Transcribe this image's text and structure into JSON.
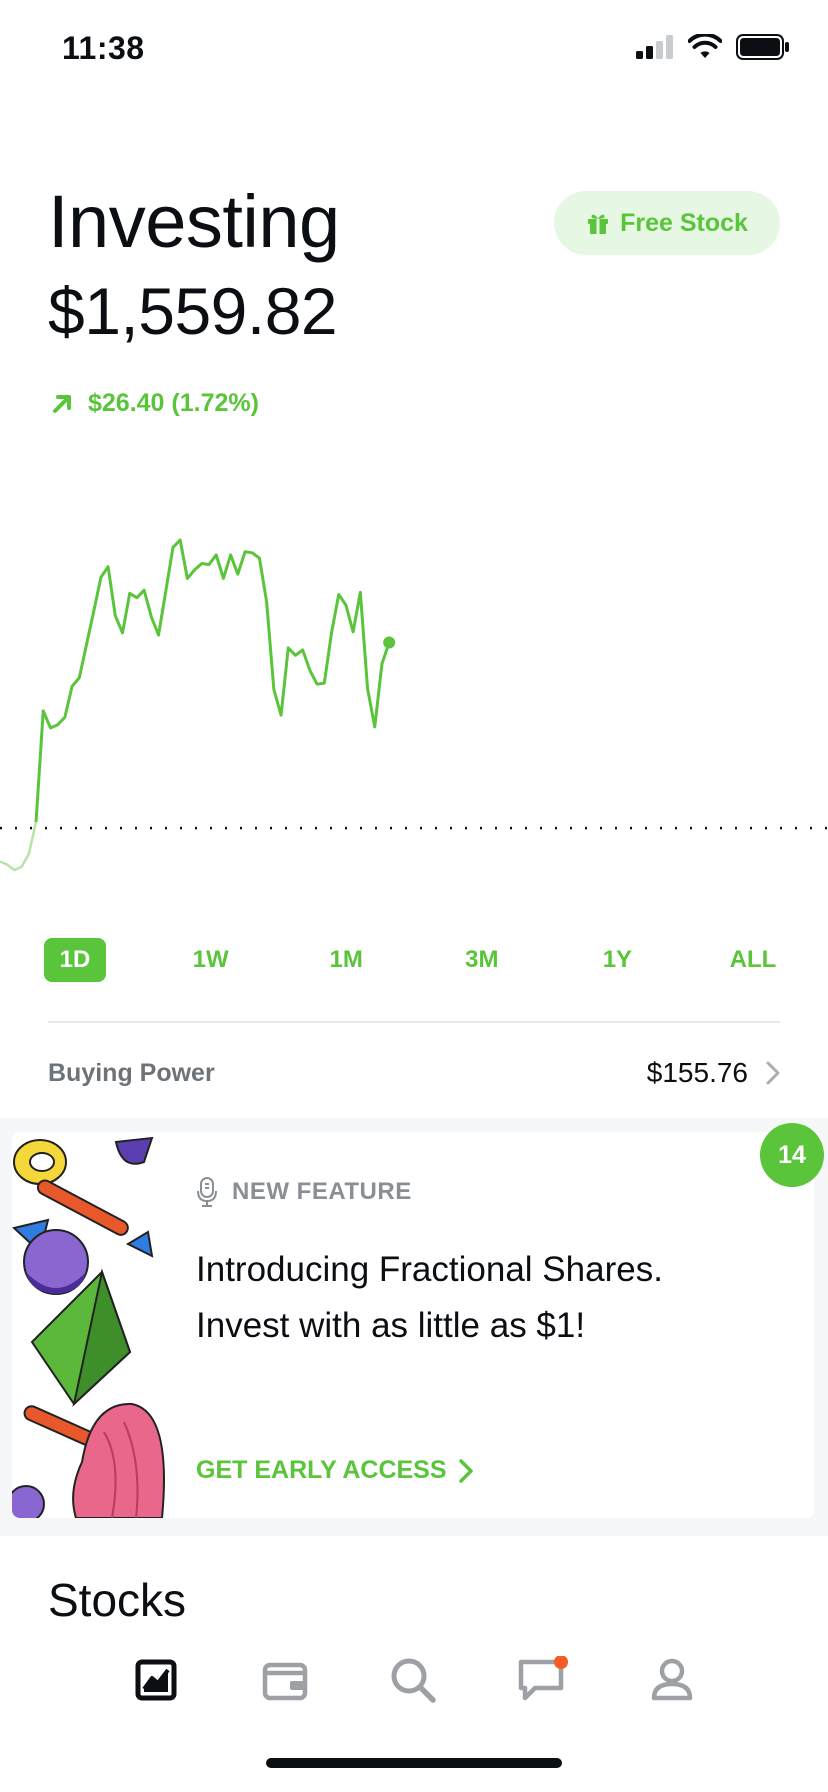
{
  "status_bar": {
    "time": "11:38"
  },
  "header": {
    "title": "Investing",
    "balance": "$1,559.82",
    "free_stock_label": "Free Stock",
    "change": "$26.40 (1.72%)"
  },
  "chart_data": {
    "type": "line",
    "title": "",
    "xlabel": "",
    "ylabel": "",
    "previous_close": 1533.42,
    "color": "#5ac53b",
    "values": [
      1530.3,
      1530.0,
      1529.5,
      1529.8,
      1531.0,
      1534.0,
      1544.4,
      1542.8,
      1543.1,
      1543.8,
      1546.7,
      1547.5,
      1550.6,
      1553.7,
      1556.9,
      1557.9,
      1553.3,
      1551.7,
      1555.4,
      1555.0,
      1555.7,
      1553.2,
      1551.5,
      1555.6,
      1559.7,
      1560.4,
      1556.8,
      1557.6,
      1558.2,
      1558.1,
      1559.0,
      1556.8,
      1559.0,
      1557.2,
      1559.3,
      1559.2,
      1558.7,
      1554.6,
      1546.4,
      1544.0,
      1550.3,
      1549.6,
      1550.1,
      1548.2,
      1546.9,
      1547.0,
      1551.7,
      1555.3,
      1554.3,
      1551.8,
      1555.5,
      1546.5,
      1542.9,
      1548.8,
      1550.8
    ],
    "session_fraction": 0.47,
    "grid": false
  },
  "ranges": [
    {
      "label": "1D",
      "active": true
    },
    {
      "label": "1W",
      "active": false
    },
    {
      "label": "1M",
      "active": false
    },
    {
      "label": "3M",
      "active": false
    },
    {
      "label": "1Y",
      "active": false
    },
    {
      "label": "ALL",
      "active": false
    }
  ],
  "buying_power": {
    "label": "Buying Power",
    "value": "$155.76"
  },
  "feature_card": {
    "badge_count": "14",
    "eyebrow": "NEW FEATURE",
    "line1": "Introducing Fractional Shares.",
    "line2": "Invest with as little as $1!",
    "cta": "GET EARLY ACCESS"
  },
  "sections": {
    "stocks_heading": "Stocks"
  },
  "tab_bar": {
    "items": [
      {
        "icon": "chart-icon",
        "active": true
      },
      {
        "icon": "wallet-icon",
        "active": false
      },
      {
        "icon": "search-icon",
        "active": false
      },
      {
        "icon": "messages-icon",
        "active": false,
        "notification": true
      },
      {
        "icon": "account-icon",
        "active": false
      }
    ]
  },
  "colors": {
    "accent": "#5ac53b",
    "notification": "#f45b26",
    "text": "#0b0e12"
  }
}
